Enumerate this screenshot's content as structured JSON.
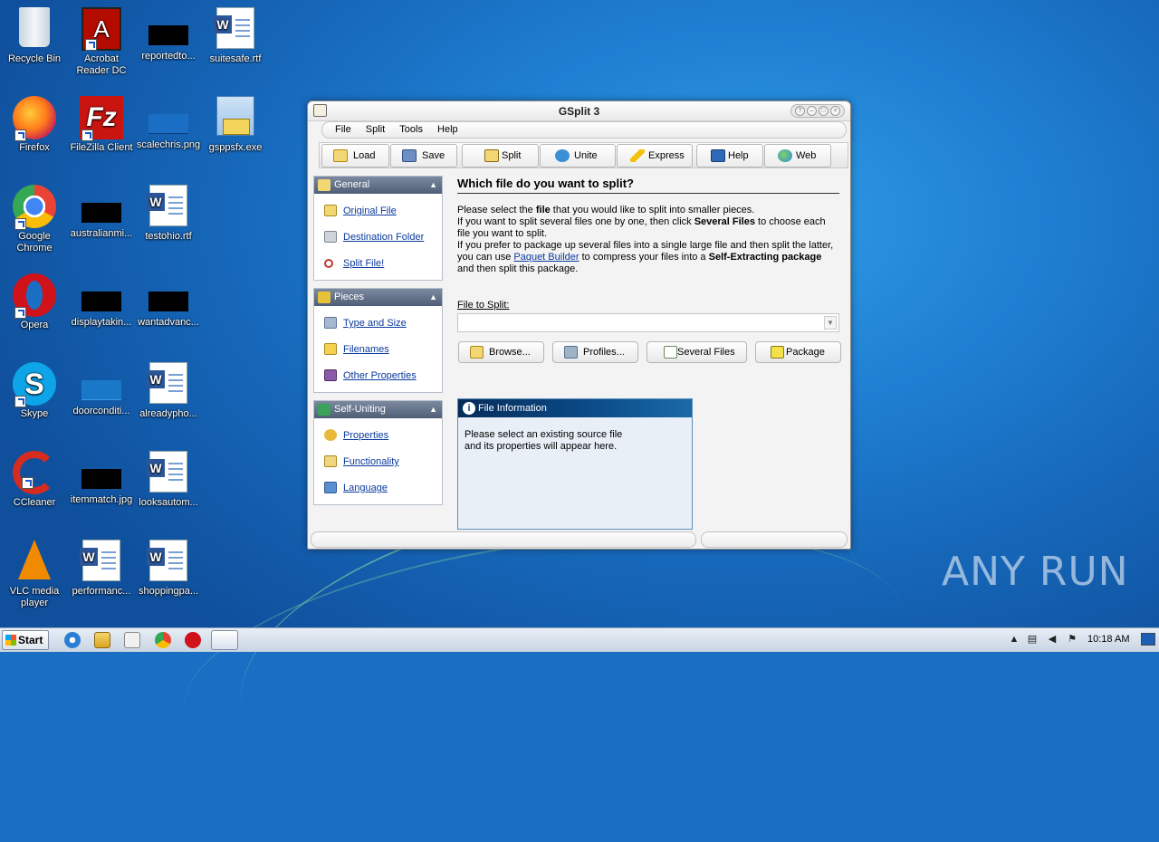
{
  "desktop": {
    "icons": [
      {
        "label": "Recycle Bin"
      },
      {
        "label": "Acrobat Reader DC"
      },
      {
        "label": "reportedto..."
      },
      {
        "label": "suitesafe.rtf"
      },
      {
        "label": "Firefox"
      },
      {
        "label": "FileZilla Client"
      },
      {
        "label": "scalechris.png"
      },
      {
        "label": "gsppsfx.exe"
      },
      {
        "label": "Google Chrome"
      },
      {
        "label": "australianmi..."
      },
      {
        "label": "testohio.rtf"
      },
      {
        "label": "Opera"
      },
      {
        "label": "displaytakin..."
      },
      {
        "label": "wantadvanc..."
      },
      {
        "label": "Skype"
      },
      {
        "label": "doorconditi..."
      },
      {
        "label": "alreadypho..."
      },
      {
        "label": "CCleaner"
      },
      {
        "label": "itemmatch.jpg"
      },
      {
        "label": "looksautom..."
      },
      {
        "label": "VLC media player"
      },
      {
        "label": "performanc..."
      },
      {
        "label": "shoppingpa..."
      }
    ],
    "watermark": "ANY RUN"
  },
  "window": {
    "title": "GSplit 3",
    "menu": [
      "File",
      "Split",
      "Tools",
      "Help"
    ],
    "toolbar": [
      "Load",
      "Save",
      "Split",
      "Unite",
      "Express",
      "Help",
      "Web"
    ]
  },
  "sidebar": {
    "general": {
      "title": "General",
      "items": [
        "Original File",
        "Destination Folder",
        "Split File!"
      ]
    },
    "pieces": {
      "title": "Pieces",
      "items": [
        "Type and Size",
        "Filenames",
        "Other Properties"
      ]
    },
    "self_uniting": {
      "title": "Self-Uniting",
      "items": [
        "Properties",
        "Functionality",
        "Language"
      ]
    }
  },
  "main": {
    "heading": "Which file do you want to split?",
    "p1_a": "Please select the ",
    "p1_b": "file",
    "p1_c": " that you would like to split into smaller pieces.",
    "p2_a": "If you want to split several files one by one, then click ",
    "p2_b": "Several Files",
    "p2_c": " to choose each file you want to split.",
    "p3_a": "If you prefer to package up several files into a single large file and then split the latter, you can use ",
    "p3_link": "Paquet Builder",
    "p3_b": " to compress your files into a ",
    "p3_c": "Self-Extracting package",
    "p3_d": " and then split this package.",
    "file_label": "File to Split:",
    "file_value": "",
    "buttons": [
      "Browse...",
      "Profiles...",
      "Several Files",
      "Package"
    ],
    "file_info": {
      "title": "File Information",
      "text": "Please select an existing source file and its properties will appear here."
    }
  },
  "taskbar": {
    "start": "Start",
    "clock": "10:18 AM"
  }
}
